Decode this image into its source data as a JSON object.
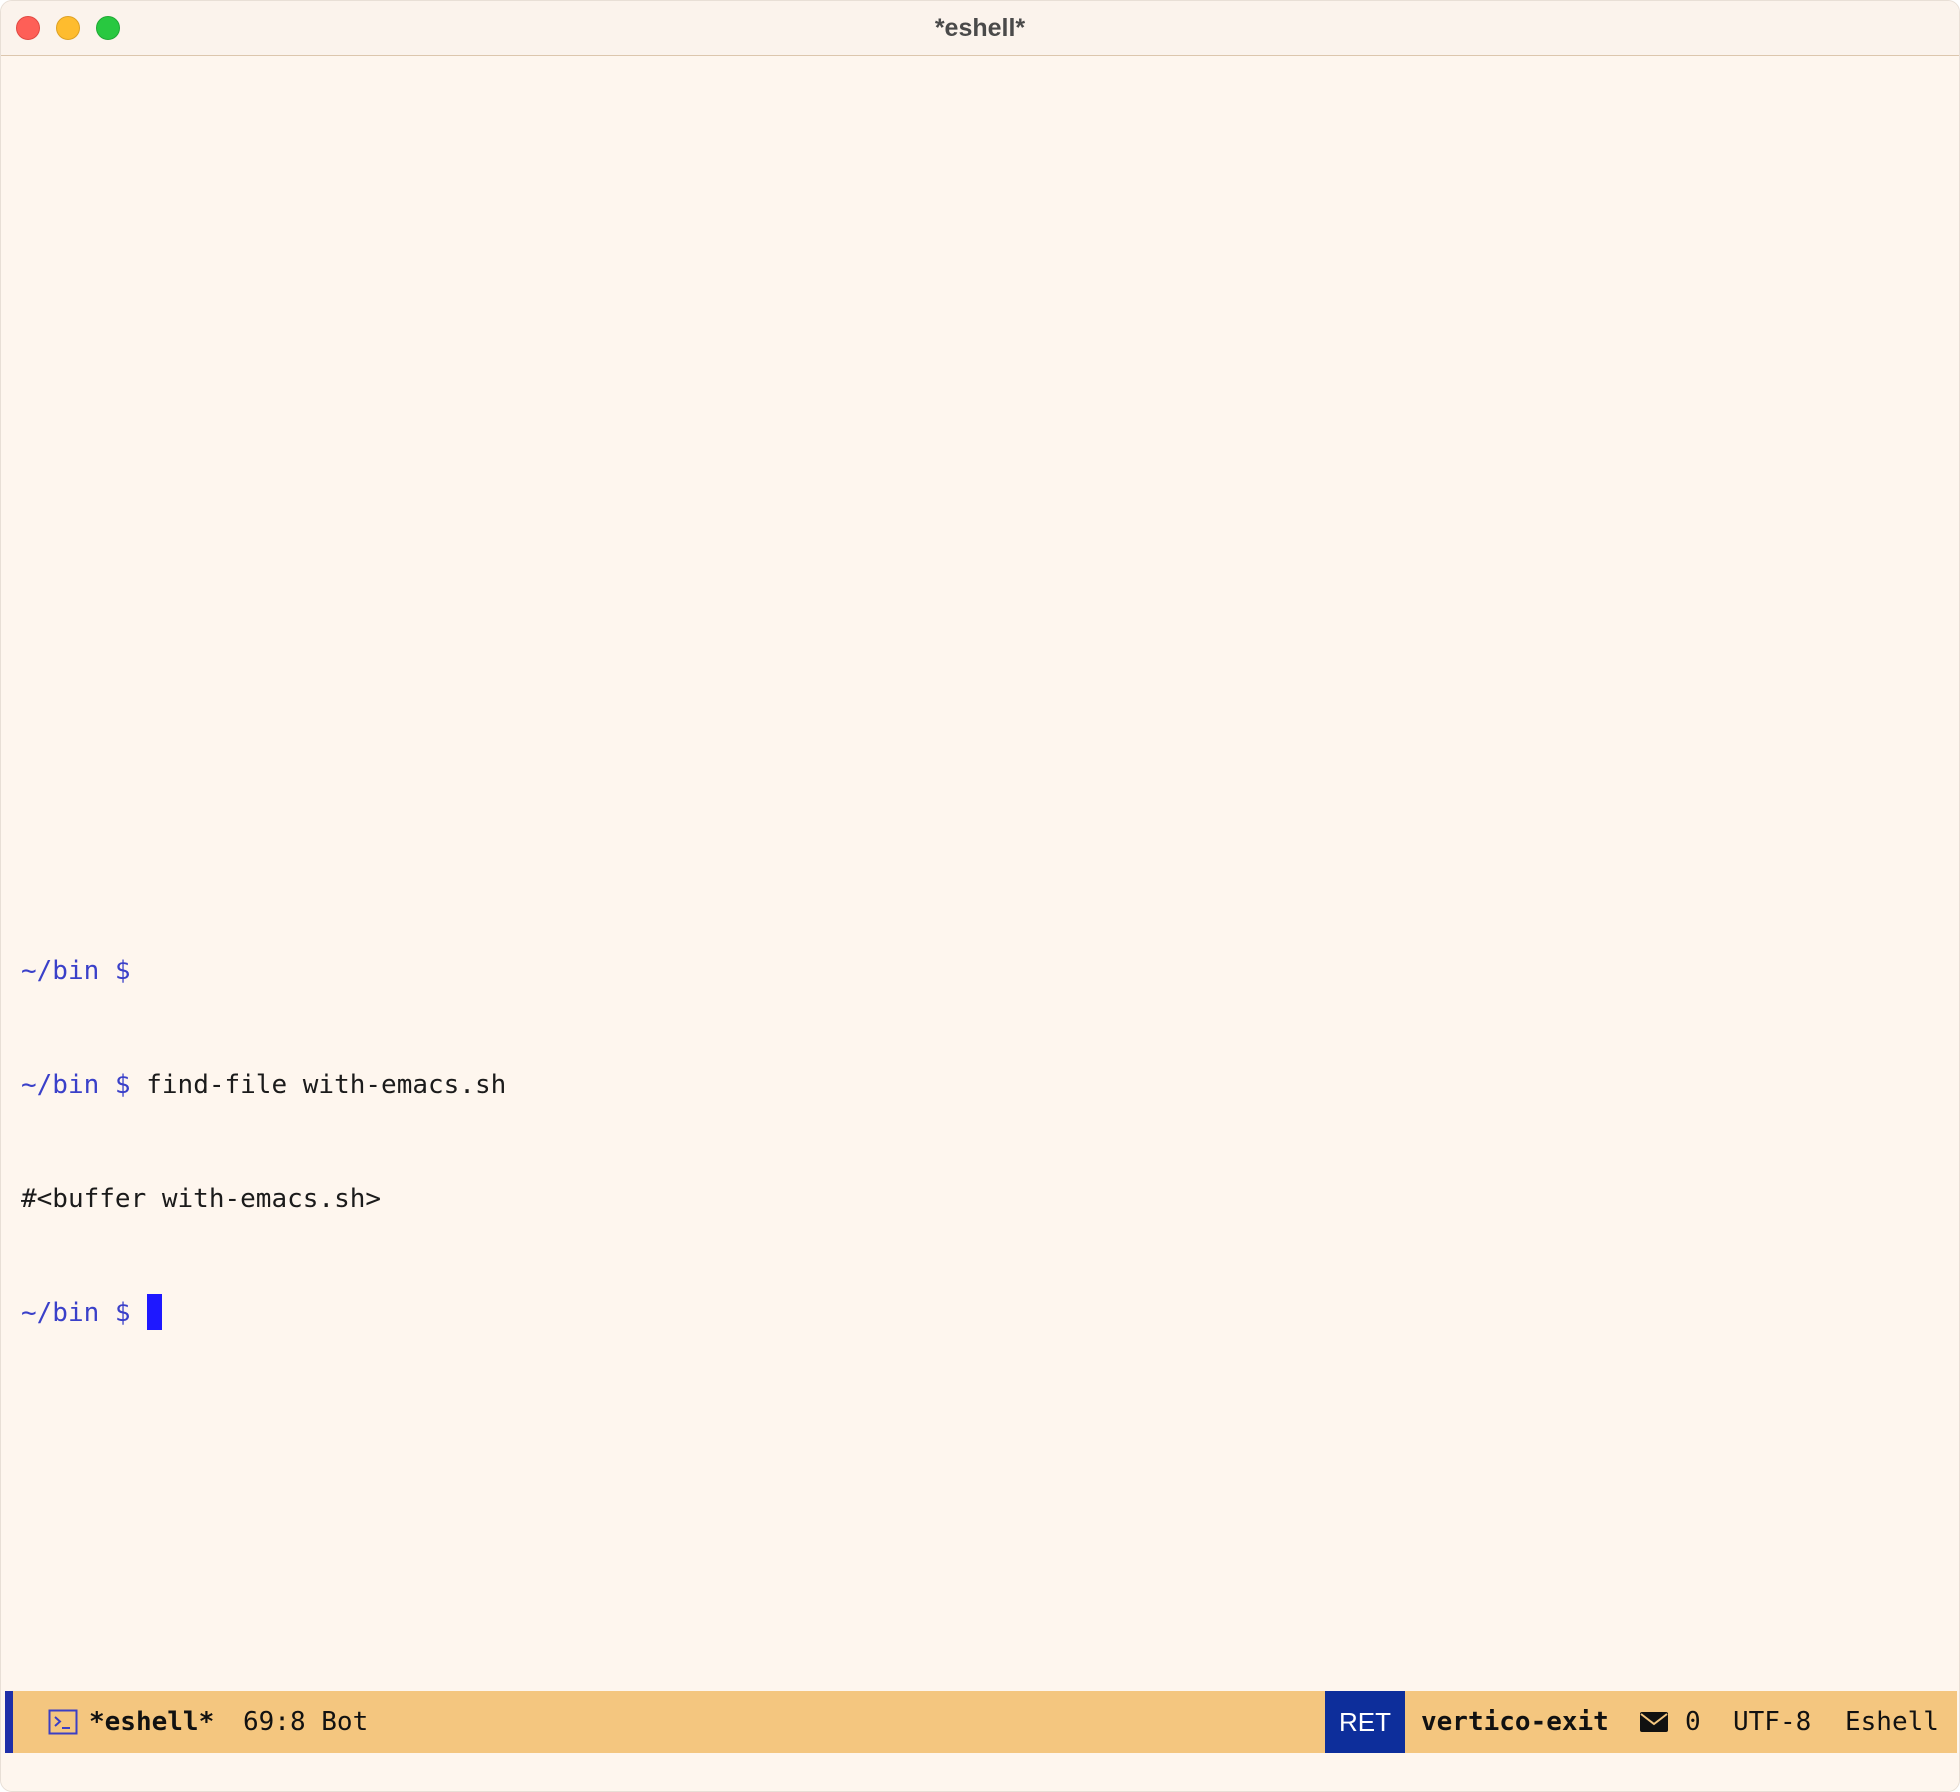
{
  "window": {
    "title": "*eshell*"
  },
  "buffer": {
    "lines": [
      {
        "prompt": "~/bin $ ",
        "text": ""
      },
      {
        "prompt": "~/bin $ ",
        "text": "find-file with-emacs.sh"
      },
      {
        "prompt": "",
        "text": "#<buffer with-emacs.sh>"
      },
      {
        "prompt": "~/bin $ ",
        "text": ""
      }
    ]
  },
  "modeline": {
    "buffer_icon": "terminal-icon",
    "buffer_name": "*eshell*",
    "position": "69:8 Bot",
    "key": "RET",
    "command": "vertico-exit",
    "mail_icon": "envelope-icon",
    "mail_count": "0",
    "encoding": "UTF-8",
    "major_mode": "Eshell"
  },
  "colors": {
    "background": "#fef6ee",
    "prompt": "#3a40c9",
    "cursor": "#1e18ff",
    "modeline_bg": "#f4c67f",
    "key_bg": "#0d2e9b",
    "close": "#fe5f57",
    "minimize": "#febc2e",
    "zoom": "#28c840"
  }
}
